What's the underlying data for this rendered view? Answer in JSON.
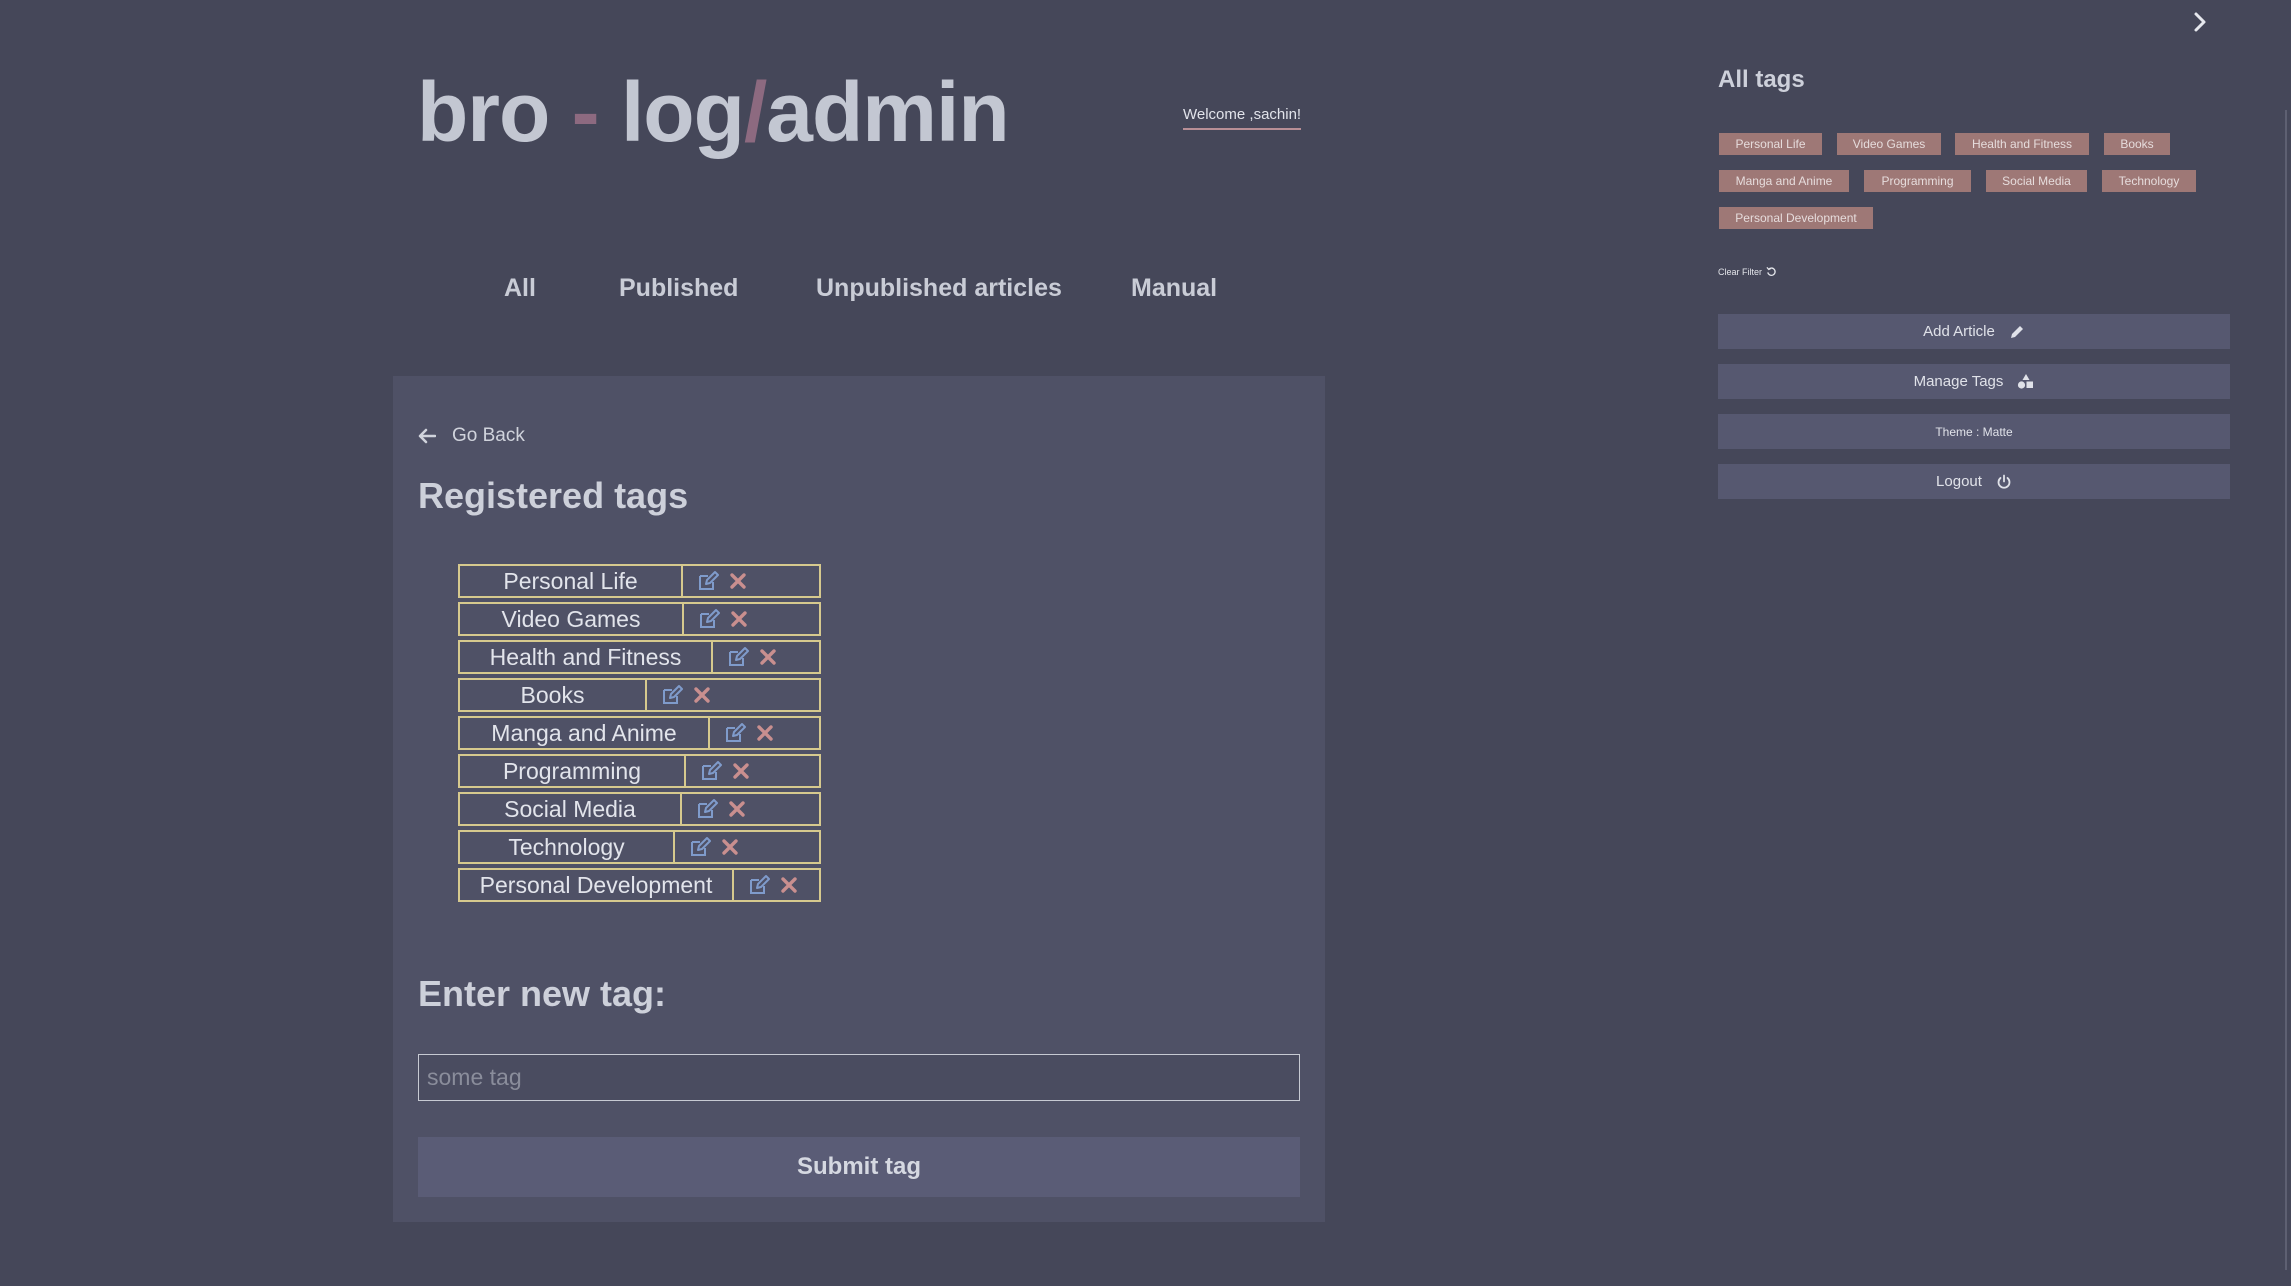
{
  "header": {
    "logo": {
      "part1": "bro",
      "sep1": " - ",
      "part2": "log",
      "sep2": "/",
      "part3": "admin"
    },
    "welcome": "Welcome ,sachin!"
  },
  "nav": {
    "items": [
      {
        "label": "All"
      },
      {
        "label": "Published"
      },
      {
        "label": "Unpublished articles"
      },
      {
        "label": "Manual"
      }
    ]
  },
  "main": {
    "go_back": "Go Back",
    "registered_title": "Registered tags",
    "tags": [
      {
        "name": "Personal Life"
      },
      {
        "name": "Video Games"
      },
      {
        "name": "Health and Fitness"
      },
      {
        "name": "Books"
      },
      {
        "name": "Manga and Anime"
      },
      {
        "name": "Programming"
      },
      {
        "name": "Social Media"
      },
      {
        "name": "Technology"
      },
      {
        "name": "Personal Development"
      }
    ],
    "new_tag_title": "Enter new tag:",
    "input_placeholder": "some tag",
    "submit_label": "Submit tag"
  },
  "sidebar": {
    "title": "All tags",
    "chips": [
      {
        "label": "Personal Life"
      },
      {
        "label": "Video Games"
      },
      {
        "label": "Health and Fitness"
      },
      {
        "label": "Books"
      },
      {
        "label": "Manga and Anime"
      },
      {
        "label": "Programming"
      },
      {
        "label": "Social Media"
      },
      {
        "label": "Technology"
      },
      {
        "label": "Personal Development"
      }
    ],
    "clear_filter": "Clear Filter",
    "add_article": "Add Article",
    "manage_tags": "Manage Tags",
    "theme": "Theme : Matte",
    "logout": "Logout"
  },
  "colors": {
    "background": "#454759",
    "panel": "#4f5166",
    "chip": "#9e7876",
    "table_border": "#d6c98e",
    "edit_icon": "#7f9bcb",
    "delete_icon": "#c98f8f",
    "logo_accent": "#8d6a80"
  },
  "icons": [
    "chevron-right-icon",
    "arrow-left-icon",
    "edit-icon",
    "close-icon",
    "refresh-icon",
    "pencil-icon",
    "shapes-icon",
    "power-icon"
  ]
}
